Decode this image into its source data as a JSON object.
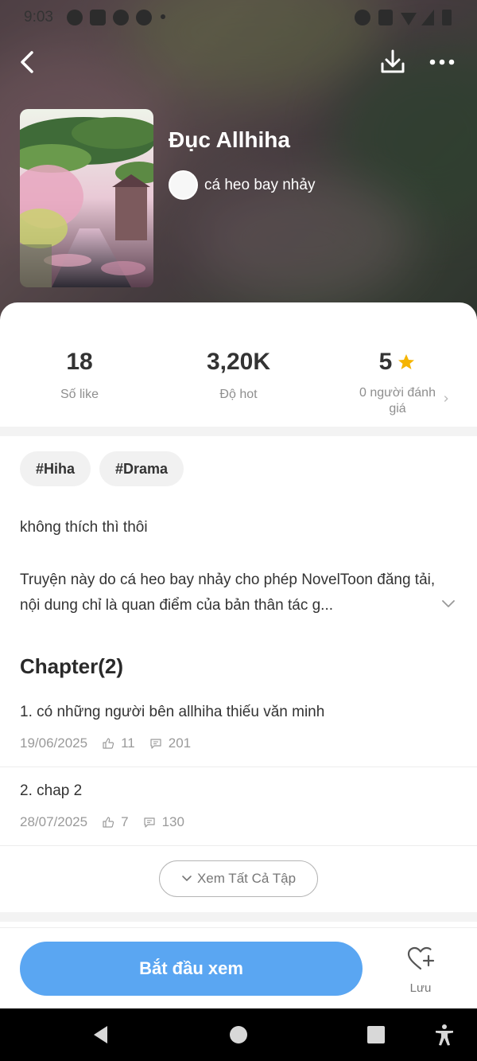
{
  "status_bar": {
    "time": "9:03"
  },
  "book": {
    "title": "Đục Allhiha",
    "author": "cá heo bay nhảy"
  },
  "stats": {
    "likes": {
      "value": "18",
      "label": "Số like"
    },
    "hot": {
      "value": "3,20K",
      "label": "Độ hot"
    },
    "rating": {
      "value": "5",
      "label": "0 người đánh giá"
    }
  },
  "tags": [
    "#Hiha",
    "#Drama"
  ],
  "description": {
    "line1": "không thích thì thôi",
    "line2": "Truyện này do cá heo bay nhảy cho phép NovelToon đăng tải, nội dung chỉ là quan điểm của bản thân tác g..."
  },
  "chapters": {
    "heading": "Chapter(2)",
    "items": [
      {
        "title": "1. có những người bên allhiha thiếu văn minh",
        "date": "19/06/2025",
        "likes": "11",
        "comments": "201"
      },
      {
        "title": "2. chap 2",
        "date": "28/07/2025",
        "likes": "7",
        "comments": "130"
      }
    ],
    "see_all_label": "Xem Tất Cả Tập"
  },
  "actions": {
    "start_label": "Bắt đầu xem",
    "save_label": "Lưu"
  },
  "colors": {
    "primary_button": "#5aa6f2",
    "star": "#f5b400"
  },
  "icons": [
    "back-arrow-icon",
    "download-icon",
    "more-icon",
    "star-icon",
    "thumbs-up-icon",
    "comment-icon",
    "chevron-down-icon",
    "heart-plus-icon"
  ]
}
